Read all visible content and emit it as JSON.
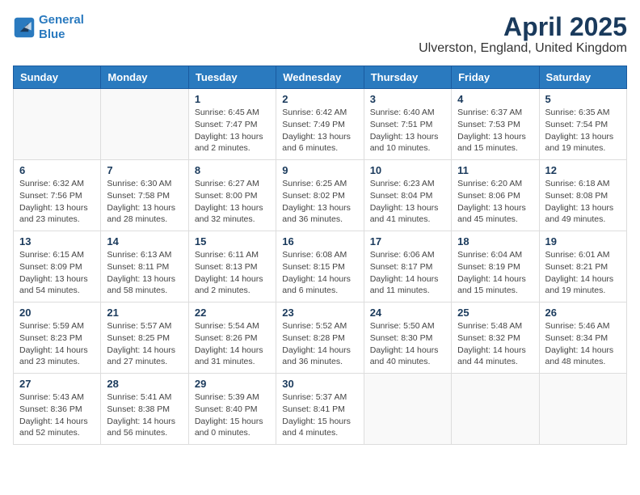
{
  "header": {
    "logo_line1": "General",
    "logo_line2": "Blue",
    "month_year": "April 2025",
    "location": "Ulverston, England, United Kingdom"
  },
  "days_of_week": [
    "Sunday",
    "Monday",
    "Tuesday",
    "Wednesday",
    "Thursday",
    "Friday",
    "Saturday"
  ],
  "weeks": [
    [
      {
        "day": "",
        "info": ""
      },
      {
        "day": "",
        "info": ""
      },
      {
        "day": "1",
        "info": "Sunrise: 6:45 AM\nSunset: 7:47 PM\nDaylight: 13 hours and 2 minutes."
      },
      {
        "day": "2",
        "info": "Sunrise: 6:42 AM\nSunset: 7:49 PM\nDaylight: 13 hours and 6 minutes."
      },
      {
        "day": "3",
        "info": "Sunrise: 6:40 AM\nSunset: 7:51 PM\nDaylight: 13 hours and 10 minutes."
      },
      {
        "day": "4",
        "info": "Sunrise: 6:37 AM\nSunset: 7:53 PM\nDaylight: 13 hours and 15 minutes."
      },
      {
        "day": "5",
        "info": "Sunrise: 6:35 AM\nSunset: 7:54 PM\nDaylight: 13 hours and 19 minutes."
      }
    ],
    [
      {
        "day": "6",
        "info": "Sunrise: 6:32 AM\nSunset: 7:56 PM\nDaylight: 13 hours and 23 minutes."
      },
      {
        "day": "7",
        "info": "Sunrise: 6:30 AM\nSunset: 7:58 PM\nDaylight: 13 hours and 28 minutes."
      },
      {
        "day": "8",
        "info": "Sunrise: 6:27 AM\nSunset: 8:00 PM\nDaylight: 13 hours and 32 minutes."
      },
      {
        "day": "9",
        "info": "Sunrise: 6:25 AM\nSunset: 8:02 PM\nDaylight: 13 hours and 36 minutes."
      },
      {
        "day": "10",
        "info": "Sunrise: 6:23 AM\nSunset: 8:04 PM\nDaylight: 13 hours and 41 minutes."
      },
      {
        "day": "11",
        "info": "Sunrise: 6:20 AM\nSunset: 8:06 PM\nDaylight: 13 hours and 45 minutes."
      },
      {
        "day": "12",
        "info": "Sunrise: 6:18 AM\nSunset: 8:08 PM\nDaylight: 13 hours and 49 minutes."
      }
    ],
    [
      {
        "day": "13",
        "info": "Sunrise: 6:15 AM\nSunset: 8:09 PM\nDaylight: 13 hours and 54 minutes."
      },
      {
        "day": "14",
        "info": "Sunrise: 6:13 AM\nSunset: 8:11 PM\nDaylight: 13 hours and 58 minutes."
      },
      {
        "day": "15",
        "info": "Sunrise: 6:11 AM\nSunset: 8:13 PM\nDaylight: 14 hours and 2 minutes."
      },
      {
        "day": "16",
        "info": "Sunrise: 6:08 AM\nSunset: 8:15 PM\nDaylight: 14 hours and 6 minutes."
      },
      {
        "day": "17",
        "info": "Sunrise: 6:06 AM\nSunset: 8:17 PM\nDaylight: 14 hours and 11 minutes."
      },
      {
        "day": "18",
        "info": "Sunrise: 6:04 AM\nSunset: 8:19 PM\nDaylight: 14 hours and 15 minutes."
      },
      {
        "day": "19",
        "info": "Sunrise: 6:01 AM\nSunset: 8:21 PM\nDaylight: 14 hours and 19 minutes."
      }
    ],
    [
      {
        "day": "20",
        "info": "Sunrise: 5:59 AM\nSunset: 8:23 PM\nDaylight: 14 hours and 23 minutes."
      },
      {
        "day": "21",
        "info": "Sunrise: 5:57 AM\nSunset: 8:25 PM\nDaylight: 14 hours and 27 minutes."
      },
      {
        "day": "22",
        "info": "Sunrise: 5:54 AM\nSunset: 8:26 PM\nDaylight: 14 hours and 31 minutes."
      },
      {
        "day": "23",
        "info": "Sunrise: 5:52 AM\nSunset: 8:28 PM\nDaylight: 14 hours and 36 minutes."
      },
      {
        "day": "24",
        "info": "Sunrise: 5:50 AM\nSunset: 8:30 PM\nDaylight: 14 hours and 40 minutes."
      },
      {
        "day": "25",
        "info": "Sunrise: 5:48 AM\nSunset: 8:32 PM\nDaylight: 14 hours and 44 minutes."
      },
      {
        "day": "26",
        "info": "Sunrise: 5:46 AM\nSunset: 8:34 PM\nDaylight: 14 hours and 48 minutes."
      }
    ],
    [
      {
        "day": "27",
        "info": "Sunrise: 5:43 AM\nSunset: 8:36 PM\nDaylight: 14 hours and 52 minutes."
      },
      {
        "day": "28",
        "info": "Sunrise: 5:41 AM\nSunset: 8:38 PM\nDaylight: 14 hours and 56 minutes."
      },
      {
        "day": "29",
        "info": "Sunrise: 5:39 AM\nSunset: 8:40 PM\nDaylight: 15 hours and 0 minutes."
      },
      {
        "day": "30",
        "info": "Sunrise: 5:37 AM\nSunset: 8:41 PM\nDaylight: 15 hours and 4 minutes."
      },
      {
        "day": "",
        "info": ""
      },
      {
        "day": "",
        "info": ""
      },
      {
        "day": "",
        "info": ""
      }
    ]
  ]
}
